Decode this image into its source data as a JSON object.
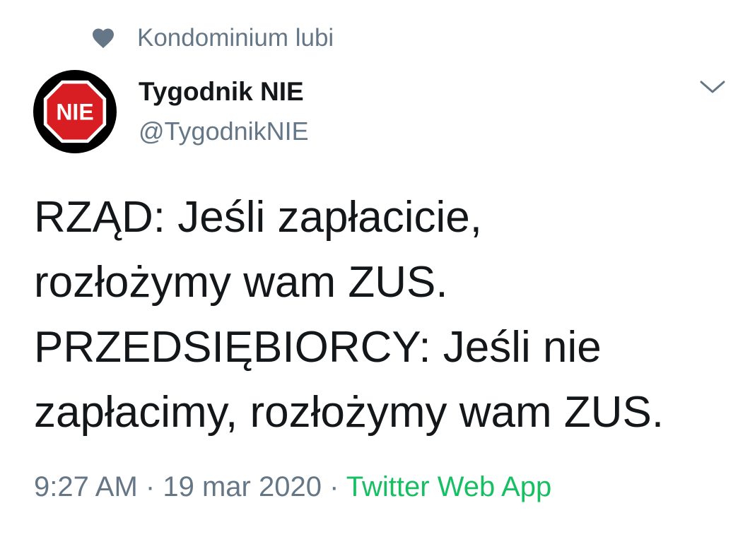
{
  "social_context": {
    "icon": "heart-icon",
    "text": "Kondominium lubi"
  },
  "author": {
    "avatar_label": "NIE",
    "display_name": "Tygodnik NIE",
    "handle": "@TygodnikNIE"
  },
  "menu": {
    "icon": "chevron-down-icon"
  },
  "tweet": {
    "text": "RZĄD: Jeśli zapłacicie,\nrozłożymy wam ZUS.\nPRZEDSIĘBIORCY: Jeśli nie\nzapłacimy, rozłożymy wam ZUS."
  },
  "meta": {
    "time": "9:27 AM",
    "separator": "·",
    "date": "19 mar 2020",
    "source": "Twitter Web App"
  },
  "colors": {
    "secondary_text": "#657786",
    "source_link": "#17bf63",
    "stop_sign_red": "#d81e22"
  }
}
